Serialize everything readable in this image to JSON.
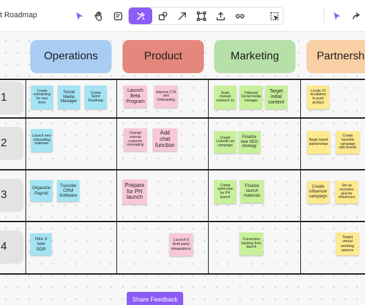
{
  "toolbar": {
    "title": "t Roadmap"
  },
  "columns": [
    "Operations",
    "Product",
    "Marketing",
    "Partnerships"
  ],
  "rows": [
    "1",
    "2",
    "3",
    "4"
  ],
  "notes": {
    "r1": {
      "ops": [
        "Create onboarding for new hires",
        "Social Media Manager",
        "Create Sprint Roadmap"
      ],
      "prod": [
        "Launch Beta Program",
        "Improve CTA and Onboarding"
      ],
      "mkt": [
        "Scale manual outreach 2x",
        "Onboard Social media manager",
        "Target initial content"
      ],
      "part": [
        "Locate 15 incubators to push product"
      ]
    },
    "r2": {
      "ops": [
        "Launch new onboarding materials"
      ],
      "prod": [
        "Change internal customer messaging",
        "Add chat function"
      ],
      "mkt": [
        "Create LinkedIn ad campaign",
        "Finalize new SEO strategy"
      ],
      "part": [
        "Begin brand partnerships",
        "Create backlink campaign with brands"
      ]
    },
    "r3": {
      "ops": [
        "Organize Payroll",
        "Transfer CRM Software"
      ],
      "prod": [
        "Prepare for PH launch"
      ],
      "mkt": [
        "Create sprint plan for PH launch",
        "Finalize launch materials"
      ],
      "part": [
        "Create influencer campaign",
        "Set up exclusive deal for influencers"
      ]
    },
    "r4": {
      "ops": [
        "Hire 3 new SDR"
      ],
      "prod": [
        "Launch 5 third party integrations"
      ],
      "mkt": [
        "Conversion tracking from launch"
      ],
      "part": [
        "Target virtual working spaces"
      ]
    }
  },
  "share_button": "Share Feedback",
  "colors": {
    "accent": "#8b5cf6",
    "operations": "#a9cdf2",
    "product": "#e4877d",
    "marketing": "#b6e0a8",
    "partnerships": "#f9cfa5",
    "note_blue": "#a3e4f3",
    "note_pink": "#f8c8d6",
    "note_green": "#c8f09a",
    "note_yellow": "#fdea8e"
  },
  "icons": [
    "pointer-icon",
    "hand-icon",
    "note-icon",
    "tools-icon",
    "shapes-icon",
    "arrow-icon",
    "frame-icon",
    "upload-icon",
    "link-icon",
    "more-icon",
    "select-icon",
    "share-icon"
  ]
}
